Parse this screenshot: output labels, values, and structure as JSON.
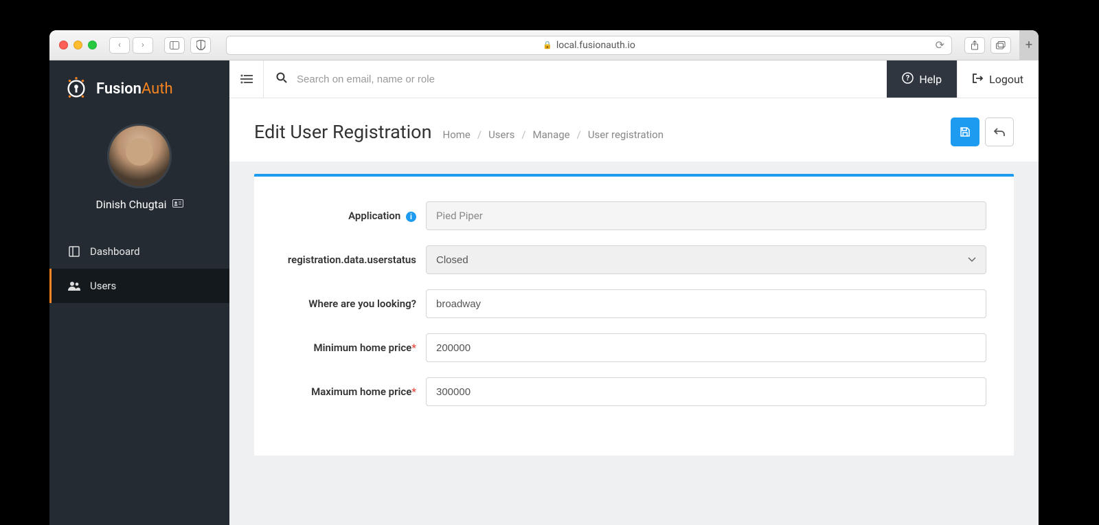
{
  "browser": {
    "url": "local.fusionauth.io"
  },
  "brand": {
    "name_left": "Fusion",
    "name_right": "Auth"
  },
  "profile": {
    "username": "Dinish Chugtai"
  },
  "sidebar": {
    "items": [
      {
        "label": "Dashboard",
        "icon": "dashboard-icon",
        "active": false
      },
      {
        "label": "Users",
        "icon": "users-icon",
        "active": true
      }
    ]
  },
  "topbar": {
    "search_placeholder": "Search on email, name or role",
    "help_label": "Help",
    "logout_label": "Logout"
  },
  "page": {
    "title": "Edit User Registration"
  },
  "breadcrumb": {
    "items": [
      "Home",
      "Users",
      "Manage",
      "User registration"
    ]
  },
  "form": {
    "application": {
      "label": "Application",
      "value": "Pied Piper"
    },
    "userstatus": {
      "label": "registration.data.userstatus",
      "value": "Closed"
    },
    "looking": {
      "label": "Where are you looking?",
      "value": "broadway"
    },
    "minprice": {
      "label": "Minimum home price",
      "value": "200000"
    },
    "maxprice": {
      "label": "Maximum home price",
      "value": "300000"
    }
  }
}
